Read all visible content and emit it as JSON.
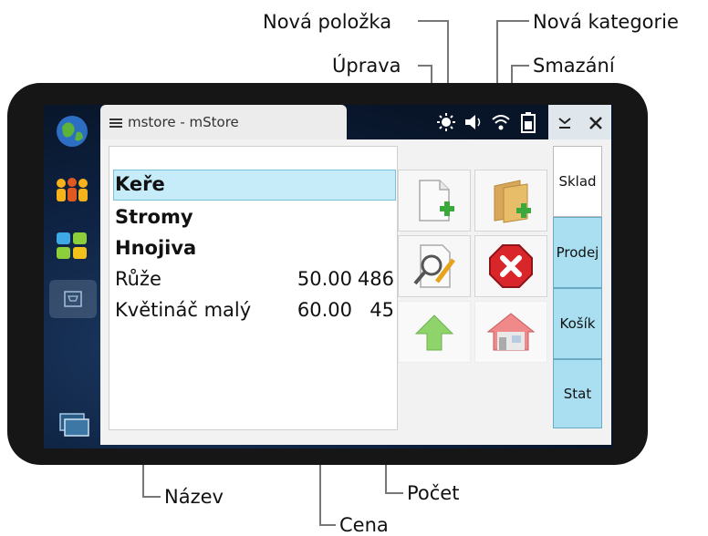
{
  "annotations": {
    "nova_polozka": "Nová položka",
    "nova_kategorie": "Nová kategorie",
    "uprava": "Úprava",
    "smazani": "Smazání",
    "nazev": "Název",
    "cena": "Cena",
    "pocet": "Počet"
  },
  "window": {
    "title": "mstore - mStore"
  },
  "list": {
    "categories": [
      "Keře",
      "Stromy",
      "Hnojiva"
    ],
    "items": [
      {
        "name": "Růže",
        "price": "50.00",
        "count": "486"
      },
      {
        "name": "Květináč malý",
        "price": "60.00",
        "count": "45"
      }
    ]
  },
  "tabs": [
    "Sklad",
    "Prodej",
    "Košík",
    "Stat"
  ],
  "active_tab": "Sklad",
  "colors": {
    "selected_row": "#c5ecf8",
    "tab": "#a9dff1",
    "device": "#161616"
  },
  "icons": [
    "globe-icon",
    "people-icon",
    "apps-icon",
    "cart-icon",
    "windows-icon",
    "brightness-icon",
    "volume-icon",
    "wifi-icon",
    "battery-icon",
    "minimize-icon",
    "close-icon"
  ]
}
